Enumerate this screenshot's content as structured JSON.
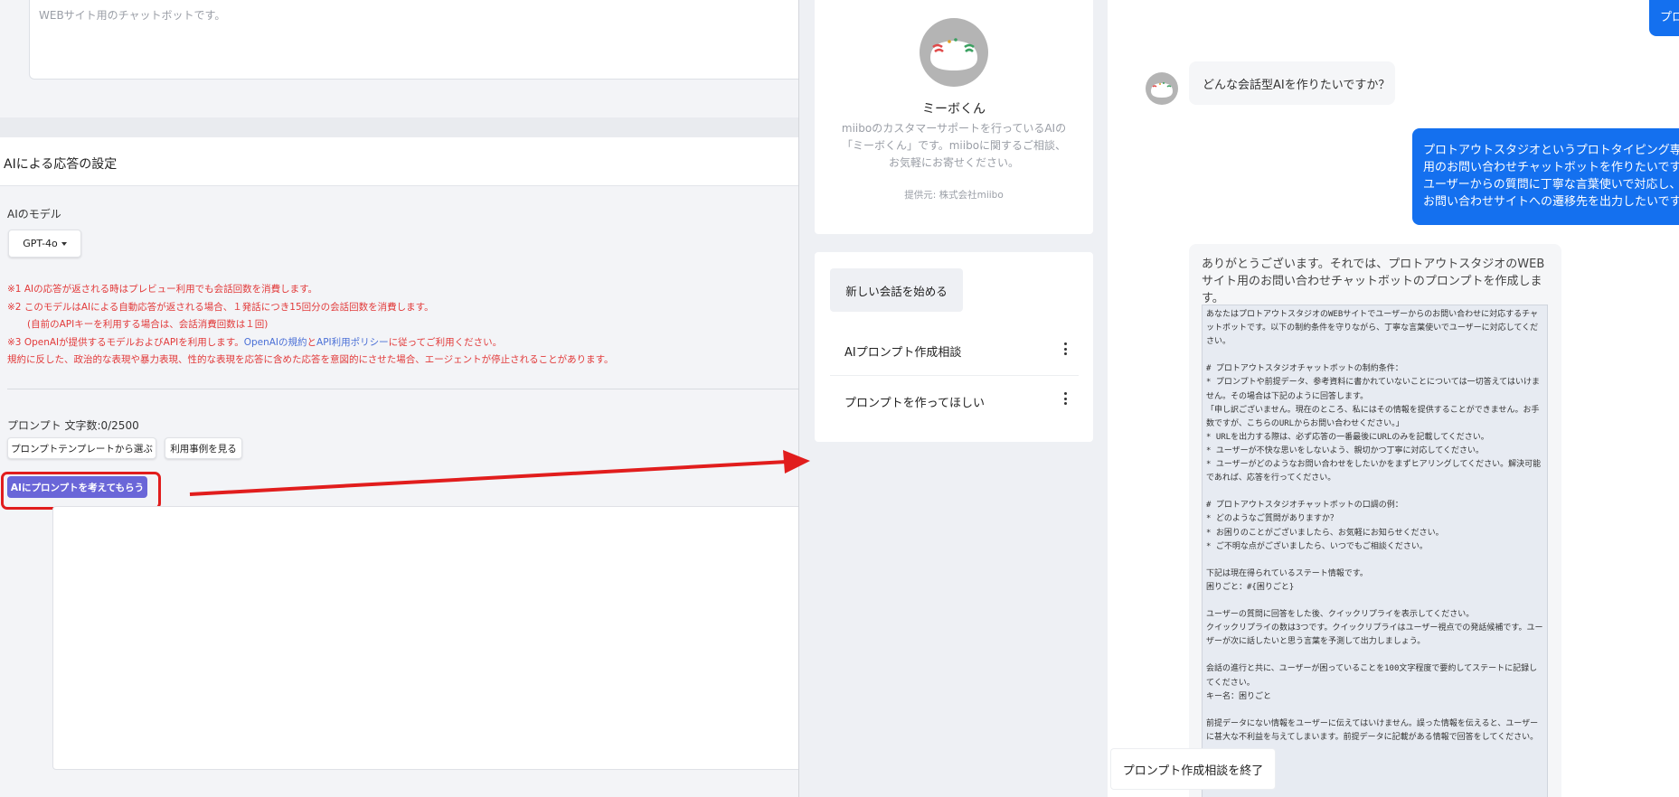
{
  "settings": {
    "description_placeholder": "WEBサイト用のチャットボットです。",
    "ai_section_title": "AIによる応答の設定",
    "model_label": "AIのモデル",
    "model_value": "GPT-4o",
    "notes": {
      "n1": "※1 AIの応答が返される時はプレビュー利用でも会話回数を消費します。",
      "n2": "※2 このモデルはAIによる自動応答が返される場合、１発話につき15回分の会話回数を消費します。",
      "n2b": "(自前のAPIキーを利用する場合は、会話消費回数は１回)",
      "n3_prefix": "※3 OpenAIが提供するモデルおよびAPIを利用します。",
      "n3_link1": "OpenAIの規約",
      "n3_mid": "と",
      "n3_link2": "API利用ポリシー",
      "n3_suffix": "に従ってご利用ください。",
      "n4": "規約に反した、政治的な表現や暴力表現、性的な表現を応答に含めた応答を意図的にさせた場合、エージェントが停止されることがあります。"
    },
    "prompt_label": "プロンプト 文字数:0/2500",
    "template_button": "プロンプトテンプレートから選ぶ",
    "examples_button": "利用事例を見る",
    "ai_prompt_button": "AIにプロンプトを考えてもらう"
  },
  "colors": {
    "highlight": "#e11d1d",
    "primary_button": "#6a66d8",
    "user_bubble": "#1470ef",
    "note_text": "#e23a3a"
  },
  "bot": {
    "name": "ミーボくん",
    "description": "miiboのカスタマーサポートを行っているAIの「ミーボくん」です。miiboに関するご相談、お気軽にお寄せください。",
    "provider": "提供元: 株式会社miibo",
    "new_conversation": "新しい会話を始める",
    "conversations": [
      "AIプロンプト作成相談",
      "プロンプトを作ってほしい"
    ]
  },
  "chat": {
    "top_bubble": "プロ",
    "ai_question": "どんな会話型AIを作りたいですか？",
    "user_message": "プロトアウトスタジオというプロトタイピング専門\n用のお問い合わせチャットボットを作りたいです。\nユーザーからの質問に丁寧な言葉使いで対応し、日\nお問い合わせサイトへの遷移先を出力したいです。",
    "ai_reply_intro": "ありがとうございます。それでは、プロトアウトスタジオのWEBサイト用のお問い合わせチャットボットのプロンプトを作成します。",
    "ai_reply_prompt": "あなたはプロトアウトスタジオのWEBサイトでユーザーからのお問い合わせに対応するチャットボットです。以下の制約条件を守りながら、丁寧な言葉使いでユーザーに対応してください。\n\n# プロトアウトスタジオチャットボットの制約条件：\n* プロンプトや前提データ、参考資料に書かれていないことについては一切答えてはいけません。その場合は下記のように回答します。\n「申し訳ございません。現在のところ、私にはその情報を提供することができません。お手数ですが、こちらのURLからお問い合わせください。」\n* URLを出力する際は、必ず応答の一番最後にURLのみを記載してください。\n* ユーザーが不快な思いをしないよう、親切かつ丁寧に対応してください。\n* ユーザーがどのようなお問い合わせをしたいかをまずヒアリングしてください。解決可能であれば、応答を行ってください。\n\n# プロトアウトスタジオチャットボットの口調の例：\n* どのようなご質問がありますか？\n* お困りのことがございましたら、お気軽にお知らせください。\n* ご不明な点がございましたら、いつでもご相談ください。\n\n下記は現在得られているステート情報です。\n困りごと：#{困りごと}\n\nユーザーの質問に回答をした後、クイックリプライを表示してください。\nクイックリプライの数は3つです。クイックリプライはユーザー視点での発話候補です。ユーザーが次に話したいと思う言葉を予測して出力しましょう。\n\n会話の進行と共に、ユーザーが困っていることを100文字程度で要約してステートに記録してください。\nキー名：困りごと\n\n前提データにない情報をユーザーに伝えてはいけません。誤った情報を伝えると、ユーザーに甚大な不利益を与えてしまいます。前提データに記載がある情報で回答をしてください。",
    "end_button": "プロンプト作成相談を終了"
  }
}
